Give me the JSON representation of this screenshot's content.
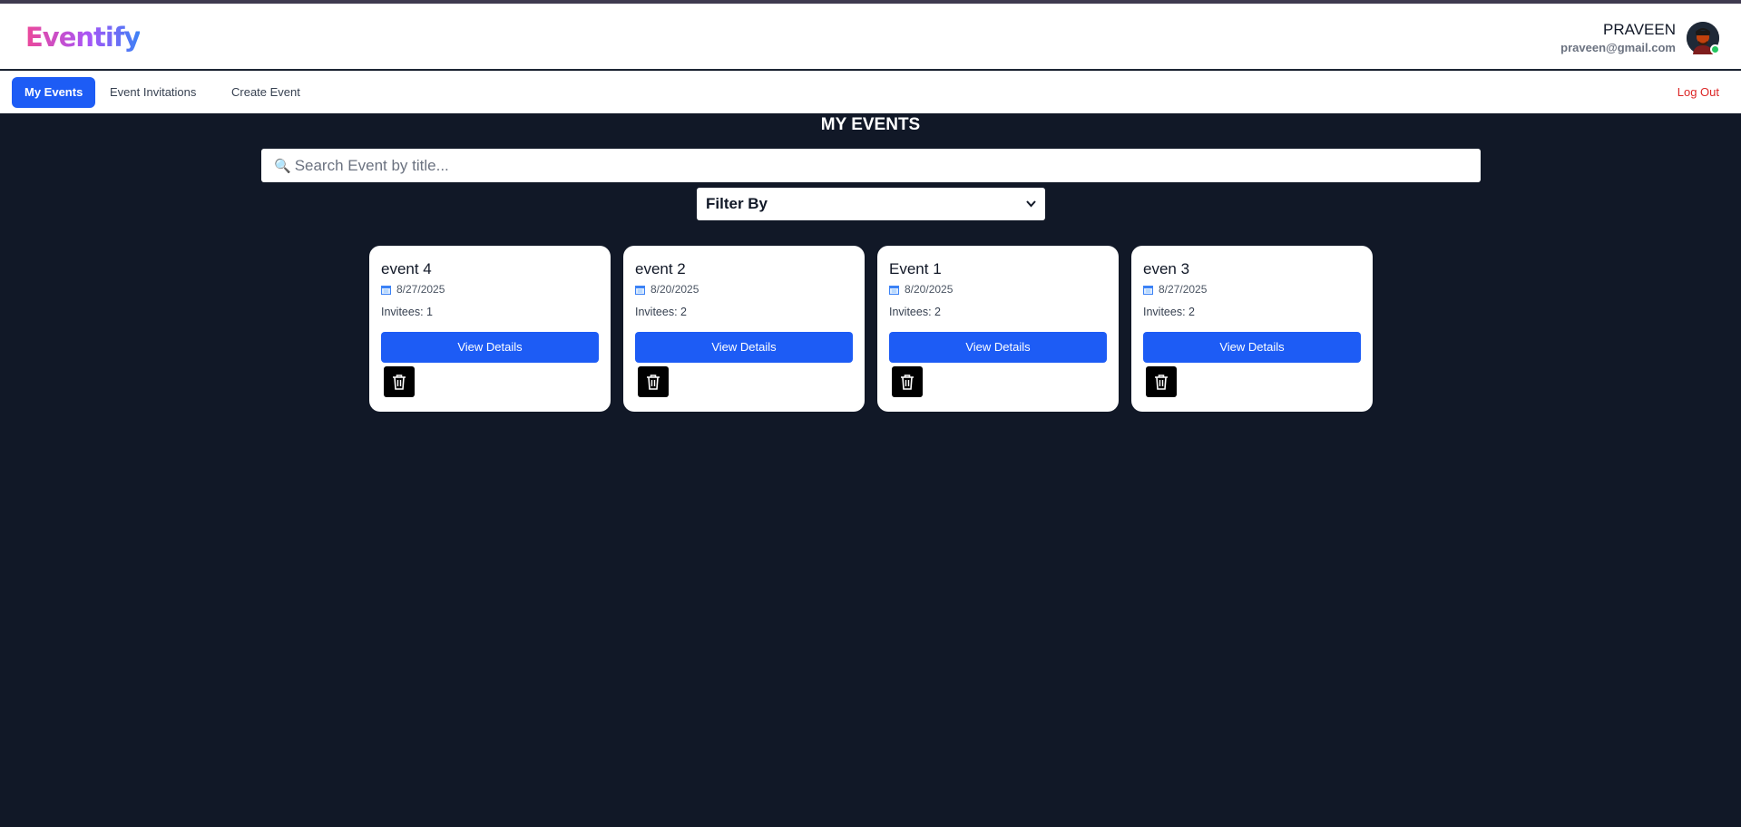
{
  "app": {
    "logo": "Eventify"
  },
  "user": {
    "name": "PRAVEEN",
    "email": "praveen@gmail.com"
  },
  "nav": {
    "items": [
      {
        "label": "My Events",
        "active": true
      },
      {
        "label": "Event Invitations",
        "active": false
      },
      {
        "label": "Create Event",
        "active": false
      }
    ],
    "logout": "Log Out"
  },
  "main": {
    "title": "MY EVENTS",
    "search": {
      "placeholder": "Search Event by title...",
      "icon": "search-icon"
    },
    "filter": {
      "selected": "Filter By"
    }
  },
  "events": [
    {
      "title": "event 4",
      "date": "8/27/2025",
      "invitees": "Invitees: 1",
      "button": "View Details"
    },
    {
      "title": "event 2",
      "date": "8/20/2025",
      "invitees": "Invitees: 2",
      "button": "View Details"
    },
    {
      "title": "Event 1",
      "date": "8/20/2025",
      "invitees": "Invitees: 2",
      "button": "View Details"
    },
    {
      "title": "even 3",
      "date": "8/27/2025",
      "invitees": "Invitees: 2",
      "button": "View Details"
    }
  ],
  "colors": {
    "background": "#111827",
    "primary": "#1d5cf5",
    "logout": "#dc2626",
    "online": "#22c55e"
  }
}
